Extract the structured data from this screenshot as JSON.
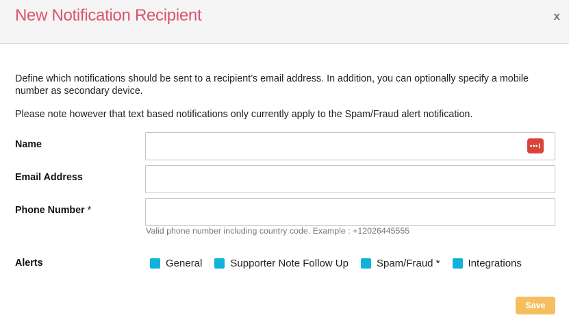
{
  "dialog": {
    "title": "New Notification Recipient",
    "close_label": "x"
  },
  "description": {
    "line1": "Define which notifications should be sent to a recipient’s email address. In addition, you can optionally specify a mobile number as secondary device.",
    "line2": "Please note however that text based notifications only currently apply to the Spam/Fraud alert notification."
  },
  "form": {
    "name": {
      "label": "Name",
      "value": ""
    },
    "email": {
      "label": "Email Address",
      "value": ""
    },
    "phone": {
      "label": "Phone Number",
      "required_mark": "*",
      "value": "",
      "help": "Valid phone number including country code. Example : +12026445555"
    },
    "alerts": {
      "label": "Alerts",
      "options": [
        {
          "label": "General",
          "checked": true
        },
        {
          "label": "Supporter Note Follow Up",
          "checked": true
        },
        {
          "label": "Spam/Fraud *",
          "checked": true
        },
        {
          "label": "Integrations",
          "checked": true
        }
      ]
    }
  },
  "actions": {
    "save_label": "Save"
  },
  "colors": {
    "title": "#d9536f",
    "checkbox": "#0fb3d9",
    "save_button": "#f5be5f",
    "password_manager_icon": "#d9443a"
  },
  "icons": {
    "close": "close-icon",
    "password_manager": "password-manager-icon",
    "checkbox": "checkbox-icon"
  }
}
